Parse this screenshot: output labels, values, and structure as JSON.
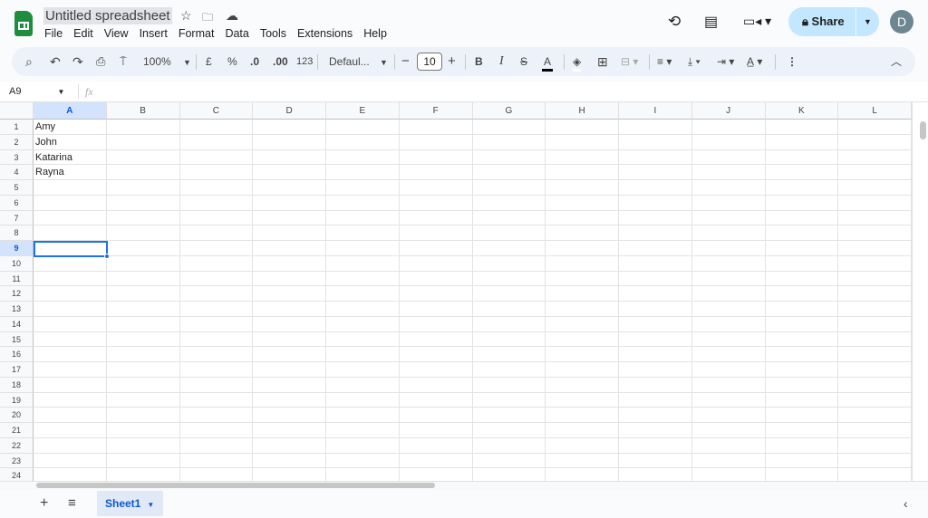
{
  "app": {
    "title": "Untitled spreadsheet"
  },
  "menu": [
    "File",
    "Edit",
    "View",
    "Insert",
    "Format",
    "Data",
    "Tools",
    "Extensions",
    "Help"
  ],
  "header": {
    "share_label": "Share",
    "avatar_initial": "D"
  },
  "toolbar": {
    "zoom": "100%",
    "currency": "£",
    "percent": "%",
    "dec_decrease": ".0",
    "dec_increase": ".00",
    "number_format": "123",
    "font": "Defaul...",
    "font_size": "10",
    "bold": "B",
    "italic": "I",
    "text_color": "A"
  },
  "formula_bar": {
    "name_box": "A9",
    "fx": "fx",
    "value": ""
  },
  "grid": {
    "columns": [
      "A",
      "B",
      "C",
      "D",
      "E",
      "F",
      "G",
      "H",
      "I",
      "J",
      "K",
      "L"
    ],
    "row_count": 24,
    "active_cell": "A9",
    "cells": {
      "A1": "Amy",
      "A2": "John",
      "A3": "Katarina",
      "A4": "Rayna"
    }
  },
  "sheets": [
    {
      "name": "Sheet1",
      "active": true
    }
  ],
  "colors": {
    "accent": "#0b57d0",
    "share_bg": "#c2e7ff",
    "sheets_green": "#1e8e3e",
    "selection": "#1a73e8"
  }
}
